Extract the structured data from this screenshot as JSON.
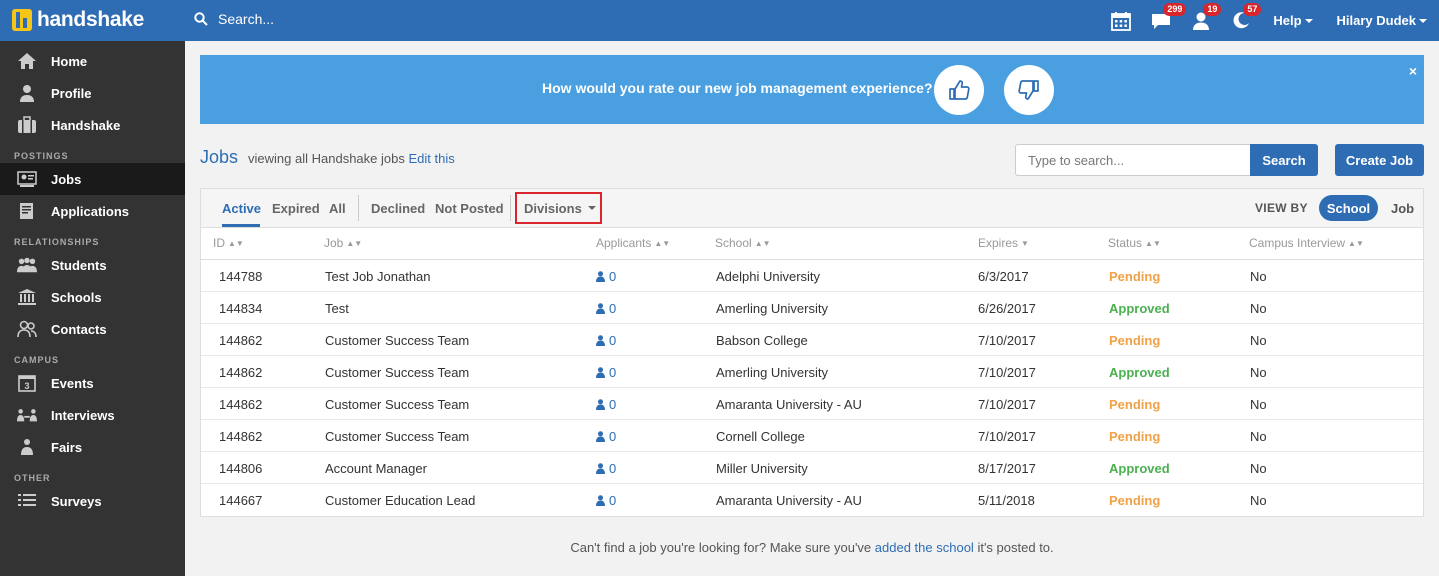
{
  "topbar": {
    "brand": "handshake",
    "search_placeholder": "Search...",
    "badges": {
      "messages": "299",
      "users": "19",
      "notifications": "57"
    },
    "help": "Help",
    "user": "Hilary Dudek"
  },
  "sidebar": {
    "items": [
      {
        "label": "Home",
        "icon": "home-icon"
      },
      {
        "label": "Profile",
        "icon": "user-icon"
      },
      {
        "label": "Handshake",
        "icon": "briefcase-icon"
      }
    ],
    "sections": [
      {
        "title": "POSTINGS",
        "items": [
          {
            "label": "Jobs",
            "icon": "jobs-icon",
            "active": true
          },
          {
            "label": "Applications",
            "icon": "applications-icon"
          }
        ]
      },
      {
        "title": "RELATIONSHIPS",
        "items": [
          {
            "label": "Students",
            "icon": "students-icon"
          },
          {
            "label": "Schools",
            "icon": "school-icon"
          },
          {
            "label": "Contacts",
            "icon": "contacts-icon"
          }
        ]
      },
      {
        "title": "CAMPUS",
        "items": [
          {
            "label": "Events",
            "icon": "calendar-icon"
          },
          {
            "label": "Interviews",
            "icon": "interviews-icon"
          },
          {
            "label": "Fairs",
            "icon": "fairs-icon"
          }
        ]
      },
      {
        "title": "OTHER",
        "items": [
          {
            "label": "Surveys",
            "icon": "surveys-icon"
          }
        ]
      }
    ]
  },
  "banner": {
    "question": "How would you rate our new job management experience?",
    "close": "×"
  },
  "jobs": {
    "title": "Jobs",
    "subtitle": "viewing all Handshake jobs",
    "edit_link": "Edit this",
    "search_placeholder": "Type to search...",
    "search_button": "Search",
    "create_button": "Create Job"
  },
  "filters": {
    "tabs": [
      "Active",
      "Expired",
      "All",
      "Declined",
      "Not Posted"
    ],
    "divisions": "Divisions",
    "view_by": "VIEW BY",
    "view_school": "School",
    "view_job": "Job"
  },
  "table": {
    "headers": [
      "ID",
      "Job",
      "Applicants",
      "School",
      "Expires",
      "Status",
      "Campus Interview"
    ],
    "rows": [
      {
        "id": "144788",
        "job": "Test Job Jonathan",
        "applicants": "0",
        "school": "Adelphi University",
        "expires": "6/3/2017",
        "status": "Pending",
        "interview": "No"
      },
      {
        "id": "144834",
        "job": "Test",
        "applicants": "0",
        "school": "Amerling University",
        "expires": "6/26/2017",
        "status": "Approved",
        "interview": "No"
      },
      {
        "id": "144862",
        "job": "Customer Success Team",
        "applicants": "0",
        "school": "Babson College",
        "expires": "7/10/2017",
        "status": "Pending",
        "interview": "No"
      },
      {
        "id": "144862",
        "job": "Customer Success Team",
        "applicants": "0",
        "school": "Amerling University",
        "expires": "7/10/2017",
        "status": "Approved",
        "interview": "No"
      },
      {
        "id": "144862",
        "job": "Customer Success Team",
        "applicants": "0",
        "school": "Amaranta University - AU",
        "expires": "7/10/2017",
        "status": "Pending",
        "interview": "No"
      },
      {
        "id": "144862",
        "job": "Customer Success Team",
        "applicants": "0",
        "school": "Cornell College",
        "expires": "7/10/2017",
        "status": "Pending",
        "interview": "No"
      },
      {
        "id": "144806",
        "job": "Account Manager",
        "applicants": "0",
        "school": "Miller University",
        "expires": "8/17/2017",
        "status": "Approved",
        "interview": "No"
      },
      {
        "id": "144667",
        "job": "Customer Education Lead",
        "applicants": "0",
        "school": "Amaranta University - AU",
        "expires": "5/11/2018",
        "status": "Pending",
        "interview": "No"
      }
    ]
  },
  "footer": {
    "text_before": "Can't find a job you're looking for? Make sure you've",
    "link": "added the school",
    "text_after": "it's posted to."
  }
}
